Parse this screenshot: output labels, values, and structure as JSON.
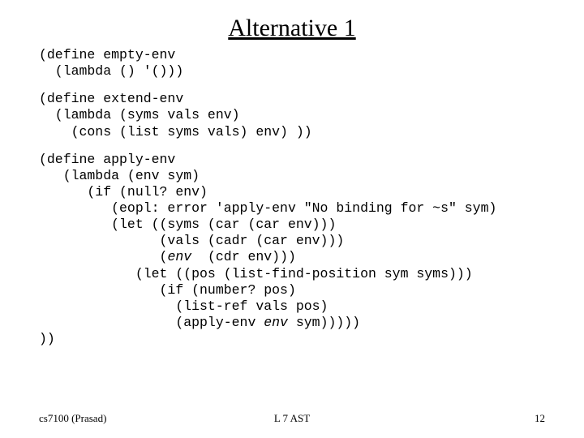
{
  "title": "Alternative 1",
  "code": {
    "block1_l1": "(define empty-env",
    "block1_l2": "  (lambda () '()))",
    "block2_l1": "(define extend-env",
    "block2_l2": "  (lambda (syms vals env)",
    "block2_l3": "    (cons (list syms vals) env) ))",
    "block3_l1": "(define apply-env",
    "block3_l2": "   (lambda (env sym)",
    "block3_l3": "      (if (null? env)",
    "block3_l4": "         (eopl: error 'apply-env \"No binding for ~s\" sym)",
    "block3_l5": "         (let ((syms (car (car env)))",
    "block3_l6": "               (vals (cadr (car env)))",
    "block3_l7a": "               (",
    "block3_env1": "env",
    "block3_l7b": "  (cdr env)))",
    "block3_l8": "            (let ((pos (list-find-position sym syms)))",
    "block3_l9": "               (if (number? pos)",
    "block3_l10": "                 (list-ref vals pos)",
    "block3_l11a": "                 (apply-env ",
    "block3_env2": "env",
    "block3_l11b": " sym)))))",
    "block3_l12": "))"
  },
  "footer": {
    "left": "cs7100 (Prasad)",
    "center": "L 7 AST",
    "right": "12"
  }
}
